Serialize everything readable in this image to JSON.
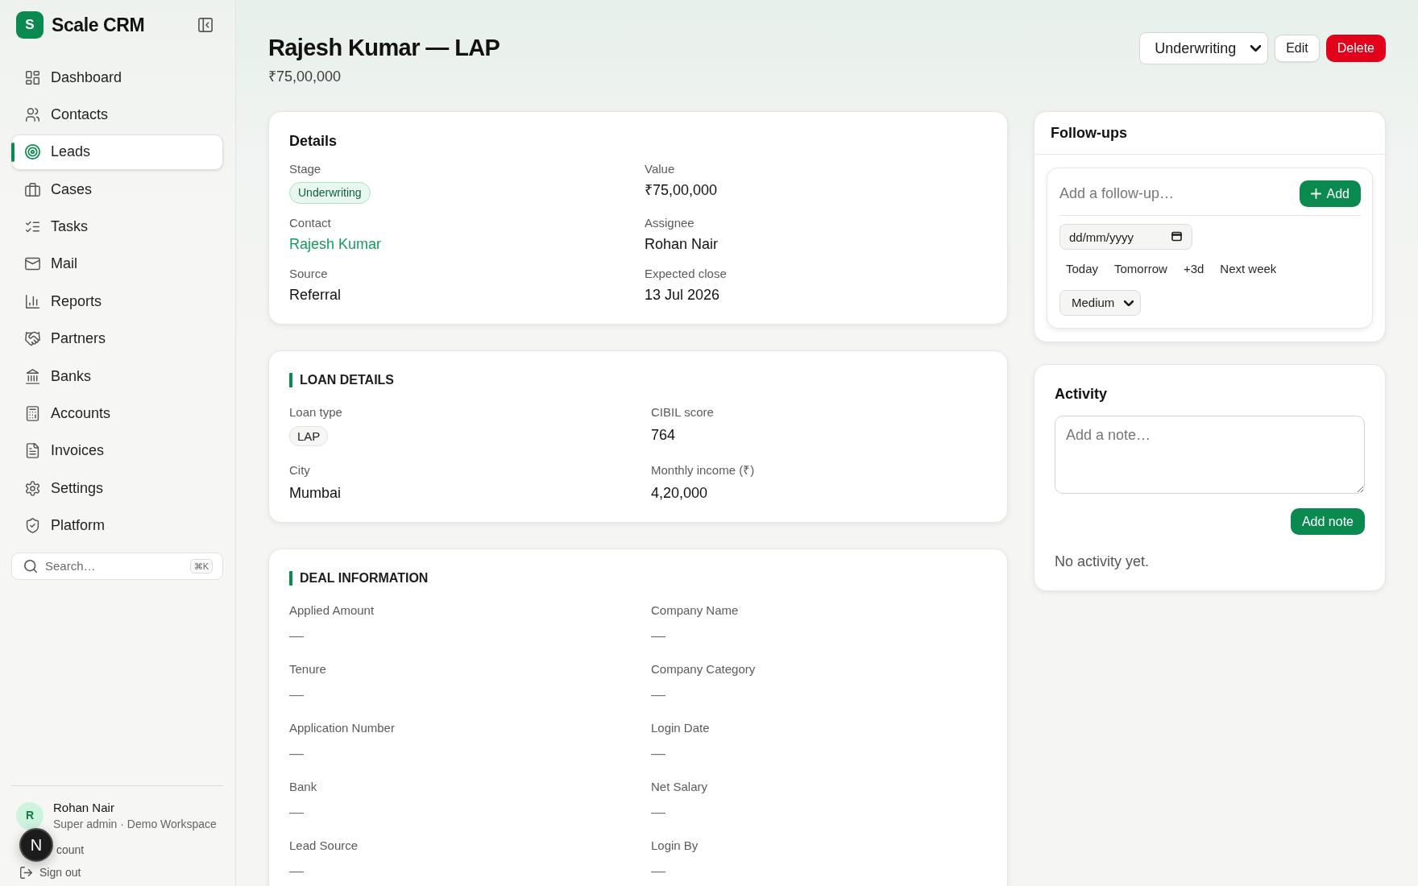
{
  "sidebar": {
    "logo": {
      "letter": "S",
      "name": "Scale CRM"
    },
    "nav_items": [
      {
        "label": "Dashboard",
        "selected": false
      },
      {
        "label": "Contacts",
        "selected": false
      },
      {
        "label": "Leads",
        "selected": true
      },
      {
        "label": "Cases",
        "selected": false
      },
      {
        "label": "Tasks",
        "selected": false
      },
      {
        "label": "Mail",
        "selected": false
      },
      {
        "label": "Reports",
        "selected": false
      },
      {
        "label": "Partners",
        "selected": false
      },
      {
        "label": "Banks",
        "selected": false
      },
      {
        "label": "Accounts",
        "selected": false
      },
      {
        "label": "Invoices",
        "selected": false
      },
      {
        "label": "Settings",
        "selected": false
      },
      {
        "label": "Platform",
        "selected": false
      }
    ],
    "search": {
      "placeholder": "Search…",
      "shortcut": "⌘K"
    },
    "user": {
      "initial": "R",
      "name": "Rohan Nair",
      "role": "Super admin · Demo Workspace"
    },
    "account_link": "count",
    "sign_out_link": "Sign out"
  },
  "dev_tools_badge": "N",
  "header": {
    "title": "Rajesh Kumar — LAP",
    "amount": "₹75,00,000",
    "stage_select": "Underwriting",
    "buttons": [
      {
        "label": "Edit",
        "kind": "secondary"
      },
      {
        "label": "Delete",
        "kind": "danger"
      }
    ]
  },
  "details": {
    "title": "Details",
    "fields": [
      {
        "label": "Stage",
        "value": "Underwriting",
        "kind": "badge"
      },
      {
        "label": "Value",
        "value": "₹75,00,000",
        "kind": "text"
      },
      {
        "label": "Contact",
        "value": "Rajesh Kumar",
        "kind": "link"
      },
      {
        "label": "Assignee",
        "value": "Rohan Nair",
        "kind": "text"
      },
      {
        "label": "Source",
        "value": "Referral",
        "kind": "text"
      },
      {
        "label": "Expected close",
        "value": "13 Jul 2026",
        "kind": "text"
      }
    ]
  },
  "loan_details": {
    "title": "LOAN DETAILS",
    "fields": [
      {
        "label": "Loan type",
        "value": "LAP",
        "kind": "chip"
      },
      {
        "label": "CIBIL score",
        "value": "764",
        "kind": "text"
      },
      {
        "label": "City",
        "value": "Mumbai",
        "kind": "text"
      },
      {
        "label": "Monthly income (₹)",
        "value": "4,20,000",
        "kind": "text"
      }
    ]
  },
  "deal_information": {
    "title": "DEAL INFORMATION",
    "fields": [
      {
        "label": "Applied Amount",
        "value": "—",
        "kind": "empty"
      },
      {
        "label": "Company Name",
        "value": "—",
        "kind": "empty"
      },
      {
        "label": "Tenure",
        "value": "—",
        "kind": "empty"
      },
      {
        "label": "Company Category",
        "value": "—",
        "kind": "empty"
      },
      {
        "label": "Application Number",
        "value": "—",
        "kind": "empty"
      },
      {
        "label": "Login Date",
        "value": "—",
        "kind": "empty"
      },
      {
        "label": "Bank",
        "value": "—",
        "kind": "empty"
      },
      {
        "label": "Net Salary",
        "value": "—",
        "kind": "empty"
      },
      {
        "label": "Lead Source",
        "value": "—",
        "kind": "empty"
      },
      {
        "label": "Login By",
        "value": "—",
        "kind": "empty"
      }
    ]
  },
  "follow_ups": {
    "title": "Follow-ups",
    "input_placeholder": "Add a follow-up…",
    "add_button": "Add",
    "date_placeholder": "dd/mm/yyyy",
    "quick_dates": [
      "Today",
      "Tomorrow",
      "+3d",
      "Next week"
    ],
    "priority": "Medium"
  },
  "activity": {
    "title": "Activity",
    "note_placeholder": "Add a note…",
    "add_button": "Add note",
    "empty_text": "No activity yet."
  }
}
